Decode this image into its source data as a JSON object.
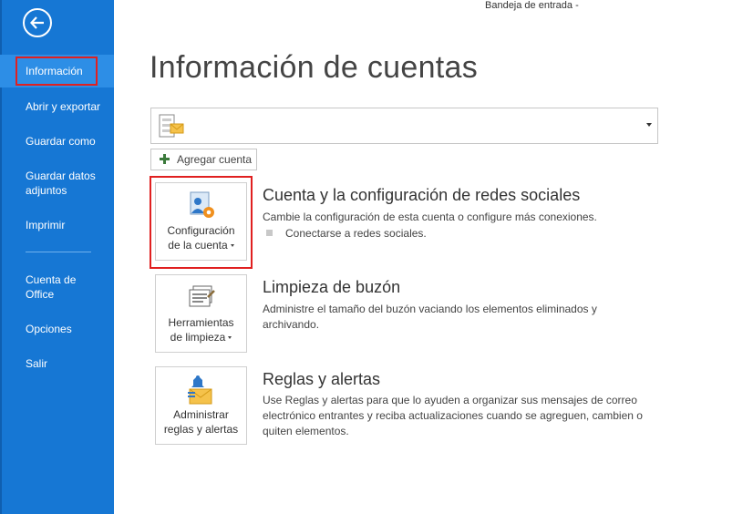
{
  "window": {
    "title": "Bandeja de entrada -"
  },
  "sidebar": {
    "items": [
      {
        "label": "Información",
        "selected": true
      },
      {
        "label": "Abrir y exportar"
      },
      {
        "label": "Guardar como"
      },
      {
        "label": "Guardar datos adjuntos"
      },
      {
        "label": "Imprimir"
      },
      {
        "label": "Cuenta de Office"
      },
      {
        "label": "Opciones"
      },
      {
        "label": "Salir"
      }
    ]
  },
  "main": {
    "title": "Información de cuentas",
    "account_selector": {
      "value": ""
    },
    "add_account_label": "Agregar cuenta",
    "sections": [
      {
        "button_line1": "Configuración",
        "button_line2": "de la cuenta",
        "title": "Cuenta y la configuración de redes sociales",
        "description": "Cambie la configuración de esta cuenta o configure más conexiones.",
        "bullet": "Conectarse a redes sociales."
      },
      {
        "button_line1": "Herramientas",
        "button_line2": "de limpieza",
        "title": "Limpieza de buzón",
        "description_line1": "Administre el tamaño del buzón vaciando los elementos eliminados y",
        "description_line2": "archivando."
      },
      {
        "button_line1": "Administrar",
        "button_line2": "reglas y alertas",
        "title": "Reglas y alertas",
        "description_line1": "Use Reglas y alertas para que lo ayuden a organizar sus mensajes de correo",
        "description_line2": "electrónico entrantes y reciba actualizaciones cuando se agreguen, cambien o",
        "description_line3": "quiten elementos."
      }
    ]
  },
  "colors": {
    "sidebar": "#1677d4",
    "selected": "#2d8ee6",
    "highlight": "#e02020"
  }
}
